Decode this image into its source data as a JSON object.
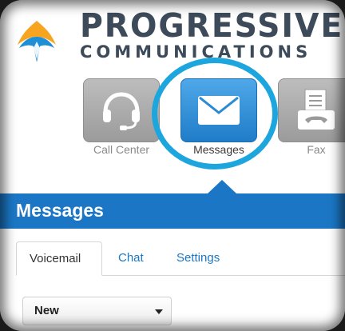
{
  "brand": {
    "name": "PROGRESSIVE",
    "tagline": "COMMUNICATIONS"
  },
  "apps": {
    "call_center": {
      "label": "Call Center",
      "icon": "headset-icon"
    },
    "messages": {
      "label": "Messages",
      "icon": "envelope-icon",
      "selected": true
    },
    "fax": {
      "label": "Fax",
      "icon": "fax-icon"
    }
  },
  "section": {
    "title": "Messages"
  },
  "tabs": {
    "voicemail": "Voicemail",
    "chat": "Chat",
    "settings": "Settings",
    "active": "Voicemail"
  },
  "filter": {
    "selected": "New"
  },
  "colors": {
    "accent": "#1b77c5",
    "highlight_ring": "#1da6dd",
    "brand_text": "#3c4a5a",
    "logo_orange": "#f7a521",
    "logo_blue": "#1e8fd6"
  }
}
